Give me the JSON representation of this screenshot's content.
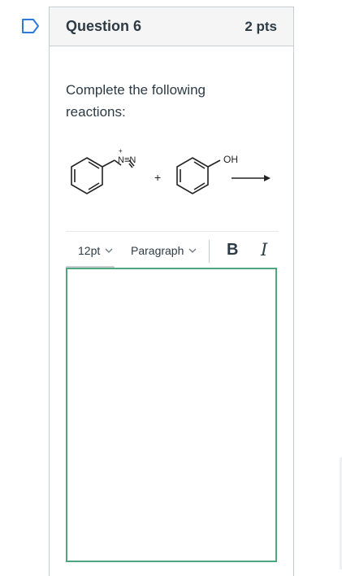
{
  "question": {
    "title": "Question 6",
    "points": "2 pts",
    "prompt": "Complete the following reactions:",
    "reaction": {
      "diazonium_label": "N≡N",
      "plus_charge": "+",
      "plus_sign": "+",
      "phenol_label": "OH"
    }
  },
  "editor": {
    "font_size": "12pt",
    "block_format": "Paragraph",
    "bold_label": "B",
    "italic_label": "I"
  },
  "colors": {
    "editor_border": "#4fa77f",
    "flag_outline": "#2d7bd6"
  },
  "icons": [
    "flag-icon",
    "chevron-down-icon",
    "arrow-right-icon"
  ]
}
